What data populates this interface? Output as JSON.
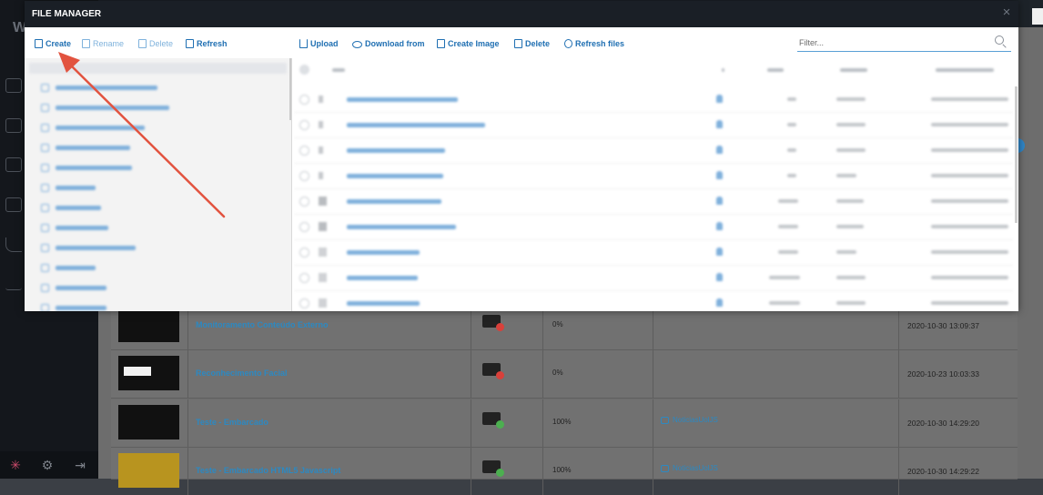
{
  "modal": {
    "title": "FILE MANAGER",
    "close_glyph": "×",
    "toolbar_left": [
      {
        "label": "Create",
        "icon": "file-plus-icon",
        "enabled": true
      },
      {
        "label": "Rename",
        "icon": "file-edit-icon",
        "enabled": false
      },
      {
        "label": "Delete",
        "icon": "file-delete-icon",
        "enabled": false
      },
      {
        "label": "Refresh",
        "icon": "refresh-icon",
        "enabled": true
      }
    ],
    "toolbar_right": [
      {
        "label": "Upload",
        "icon": "upload-icon"
      },
      {
        "label": "Download from",
        "icon": "cloud-download-icon"
      },
      {
        "label": "Create Image",
        "icon": "image-icon"
      },
      {
        "label": "Delete",
        "icon": "trash-icon"
      },
      {
        "label": "Refresh files",
        "icon": "refresh-icon"
      }
    ],
    "filter_placeholder": "Filter..."
  },
  "background_table": {
    "rows": [
      {
        "title": "Monitoramento Conteúdo Externo",
        "progress": "0%",
        "playlist": "",
        "date": "2020-10-30 13:09:37",
        "status_color": "#d9403a"
      },
      {
        "title": "Reconhecimento Facial",
        "progress": "0%",
        "playlist": "",
        "date": "2020-10-23 10:03:33",
        "status_color": "#d9403a"
      },
      {
        "title": "Teste - Embarcado",
        "progress": "100%",
        "playlist": "NoticiasUolJS",
        "date": "2020-10-30 14:29:20",
        "status_color": "#4caf50"
      },
      {
        "title": "Teste - Embarcado HTML5 Javascript",
        "progress": "100%",
        "playlist": "NoticiasUolJS",
        "date": "2020-10-30 14:29:22",
        "status_color": "#4caf50"
      }
    ]
  },
  "colors": {
    "accent": "#1f6fb2",
    "header_bg": "#1a1f26",
    "annotation_arrow": "#e2533f"
  }
}
